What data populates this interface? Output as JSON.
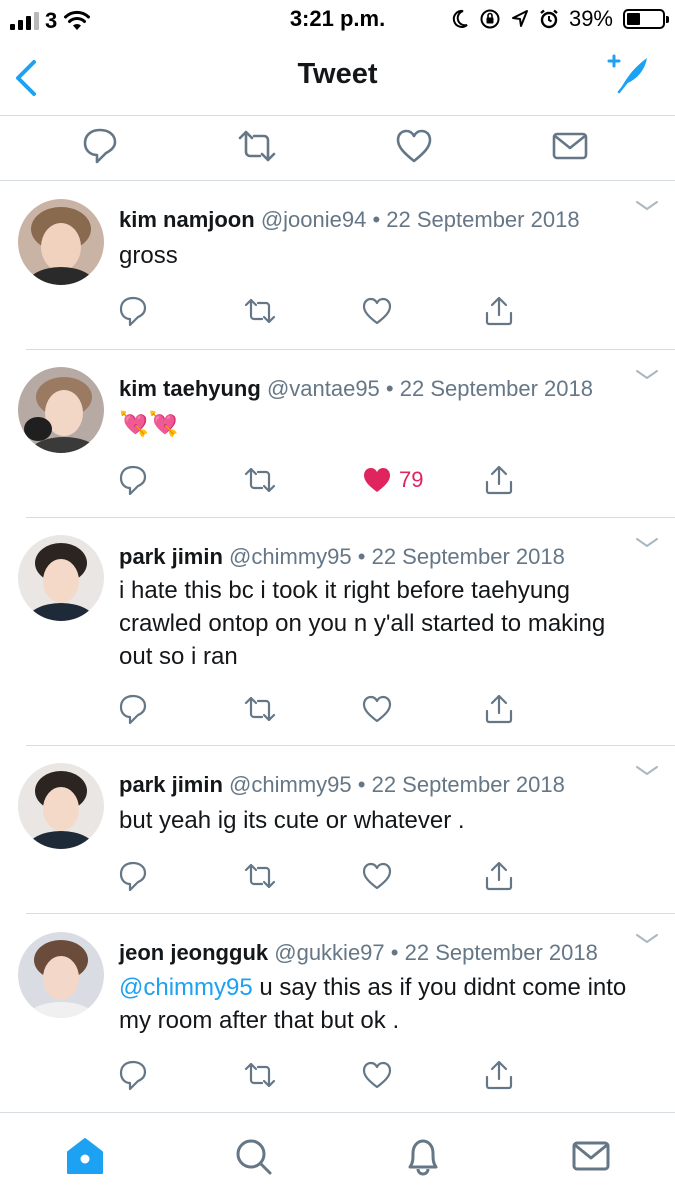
{
  "status_bar": {
    "carrier": "3",
    "time": "3:21 p.m.",
    "battery": "39%",
    "battery_level": 0.39
  },
  "nav": {
    "title": "Tweet",
    "back_icon": "chevron-left-icon",
    "compose_icon": "compose-feather-icon"
  },
  "colors": {
    "accent": "#1da1f2",
    "like": "#e0245e",
    "secondary_text": "#657786",
    "icon": "#657786"
  },
  "replies": [
    {
      "name": "kim namjoon",
      "handle": "@joonie94",
      "dot": "•",
      "date": "22 September 2018",
      "text": "gross",
      "liked": false,
      "likes": ""
    },
    {
      "name": "kim taehyung",
      "handle": "@vantae95",
      "dot": "•",
      "date": "22 September 2018",
      "text": "💘💘",
      "liked": true,
      "likes": "79"
    },
    {
      "name": "park jimin",
      "handle": "@chimmy95",
      "dot": "•",
      "date": "22 September 2018",
      "text": "i hate this bc i took it right before taehyung crawled ontop on you n y'all started to making out so i ran",
      "liked": false,
      "likes": ""
    },
    {
      "name": "park jimin",
      "handle": "@chimmy95",
      "dot": "•",
      "date": "22 September 2018",
      "text": "but yeah ig its cute or whatever .",
      "liked": false,
      "likes": ""
    },
    {
      "name": "jeon jeongguk",
      "handle": "@gukkie97",
      "dot": "•",
      "date": "22 September 2018",
      "mention": "@chimmy95",
      "text": " u say this as if you didnt come into my room after that but ok .",
      "liked": false,
      "likes": ""
    }
  ],
  "tabs": [
    {
      "icon": "home-icon",
      "active": true
    },
    {
      "icon": "search-icon",
      "active": false
    },
    {
      "icon": "bell-icon",
      "active": false
    },
    {
      "icon": "mail-icon",
      "active": false
    }
  ]
}
